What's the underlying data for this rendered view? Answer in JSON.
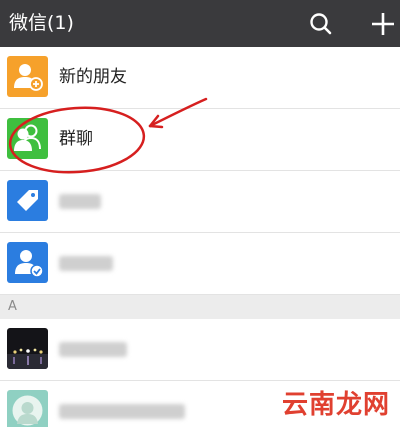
{
  "header": {
    "title": "微信(1)",
    "search_icon": "search-icon",
    "add_icon": "plus-icon"
  },
  "rows": [
    {
      "label": "新的朋友",
      "icon": "add-friend-icon",
      "color": "#f6a12b"
    },
    {
      "label": "群聊",
      "icon": "group-chat-icon",
      "color": "#3fbf3f"
    },
    {
      "label": "",
      "icon": "tag-icon",
      "color": "#2b7de0",
      "blurred": true
    },
    {
      "label": "",
      "icon": "official-account-icon",
      "color": "#2b7de0",
      "blurred": true
    }
  ],
  "section": {
    "letter": "A"
  },
  "contacts": [
    {
      "label": "",
      "icon": "contact-avatar-night",
      "blurred": true
    },
    {
      "label": "",
      "icon": "contact-avatar-person",
      "blurred": true
    }
  ],
  "annotation": {
    "color": "#d61f1f"
  },
  "watermark": {
    "text": "云南龙网"
  }
}
